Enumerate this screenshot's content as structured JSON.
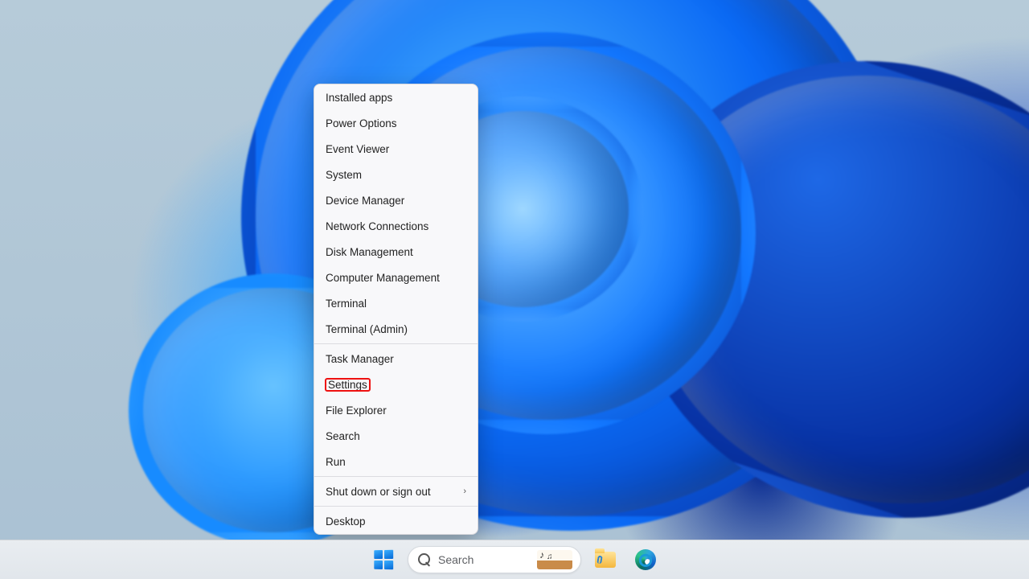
{
  "context_menu": {
    "groups": [
      {
        "items": [
          {
            "label": "Installed apps",
            "has_submenu": false,
            "highlighted": false
          },
          {
            "label": "Power Options",
            "has_submenu": false,
            "highlighted": false
          },
          {
            "label": "Event Viewer",
            "has_submenu": false,
            "highlighted": false
          },
          {
            "label": "System",
            "has_submenu": false,
            "highlighted": false
          },
          {
            "label": "Device Manager",
            "has_submenu": false,
            "highlighted": false
          },
          {
            "label": "Network Connections",
            "has_submenu": false,
            "highlighted": false
          },
          {
            "label": "Disk Management",
            "has_submenu": false,
            "highlighted": false
          },
          {
            "label": "Computer Management",
            "has_submenu": false,
            "highlighted": false
          },
          {
            "label": "Terminal",
            "has_submenu": false,
            "highlighted": false
          },
          {
            "label": "Terminal (Admin)",
            "has_submenu": false,
            "highlighted": false
          }
        ]
      },
      {
        "items": [
          {
            "label": "Task Manager",
            "has_submenu": false,
            "highlighted": false
          },
          {
            "label": "Settings",
            "has_submenu": false,
            "highlighted": true
          },
          {
            "label": "File Explorer",
            "has_submenu": false,
            "highlighted": false
          },
          {
            "label": "Search",
            "has_submenu": false,
            "highlighted": false
          },
          {
            "label": "Run",
            "has_submenu": false,
            "highlighted": false
          }
        ]
      },
      {
        "items": [
          {
            "label": "Shut down or sign out",
            "has_submenu": true,
            "highlighted": false
          }
        ]
      },
      {
        "items": [
          {
            "label": "Desktop",
            "has_submenu": false,
            "highlighted": false
          }
        ]
      }
    ]
  },
  "taskbar": {
    "search_placeholder": "Search",
    "icons": {
      "start": "start-icon",
      "search": "search-icon",
      "thumb": "search-thumbnail",
      "explorer": "file-explorer-icon",
      "edge": "edge-icon"
    }
  }
}
